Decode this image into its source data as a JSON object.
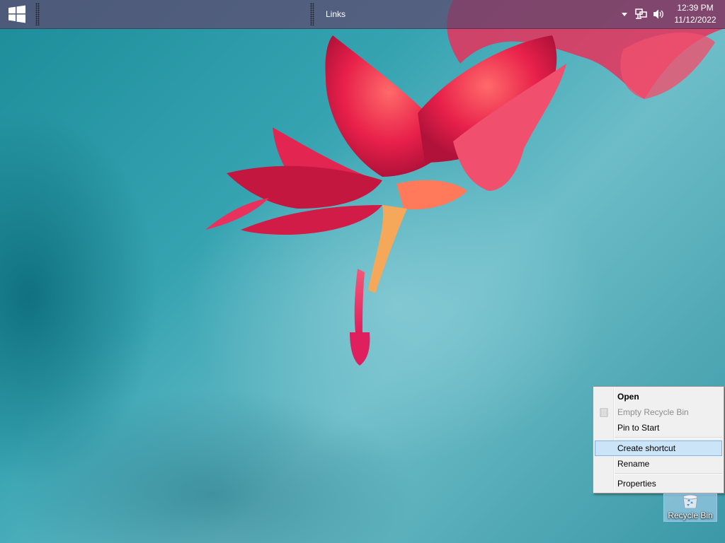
{
  "taskbar": {
    "links_label": "Links",
    "clock": {
      "time": "12:39 PM",
      "date": "11/12/2022"
    },
    "tray_icons": [
      "chevron-up-icon",
      "network-icon",
      "volume-icon"
    ]
  },
  "context_menu": {
    "items": [
      {
        "label": "Open",
        "style": "bold"
      },
      {
        "label": "Empty Recycle Bin",
        "style": "disabled",
        "icon": "recycle-bin-empty-icon"
      },
      {
        "label": "Pin to Start",
        "style": "normal"
      },
      {
        "label": "Create shortcut",
        "style": "highlighted"
      },
      {
        "label": "Rename",
        "style": "normal"
      },
      {
        "label": "Properties",
        "style": "normal"
      }
    ]
  },
  "desktop": {
    "icons": [
      {
        "label": "Recycle Bin",
        "icon": "recycle-bin-icon",
        "selected": true
      }
    ]
  },
  "colors": {
    "taskbar": "#5f466e",
    "menu_background": "#f0f0f0",
    "menu_highlight": "#cce4f7",
    "menu_highlight_border": "#7eb4ea",
    "wallpaper_teal": "#36a3b1",
    "flower_red": "#e8204a"
  }
}
